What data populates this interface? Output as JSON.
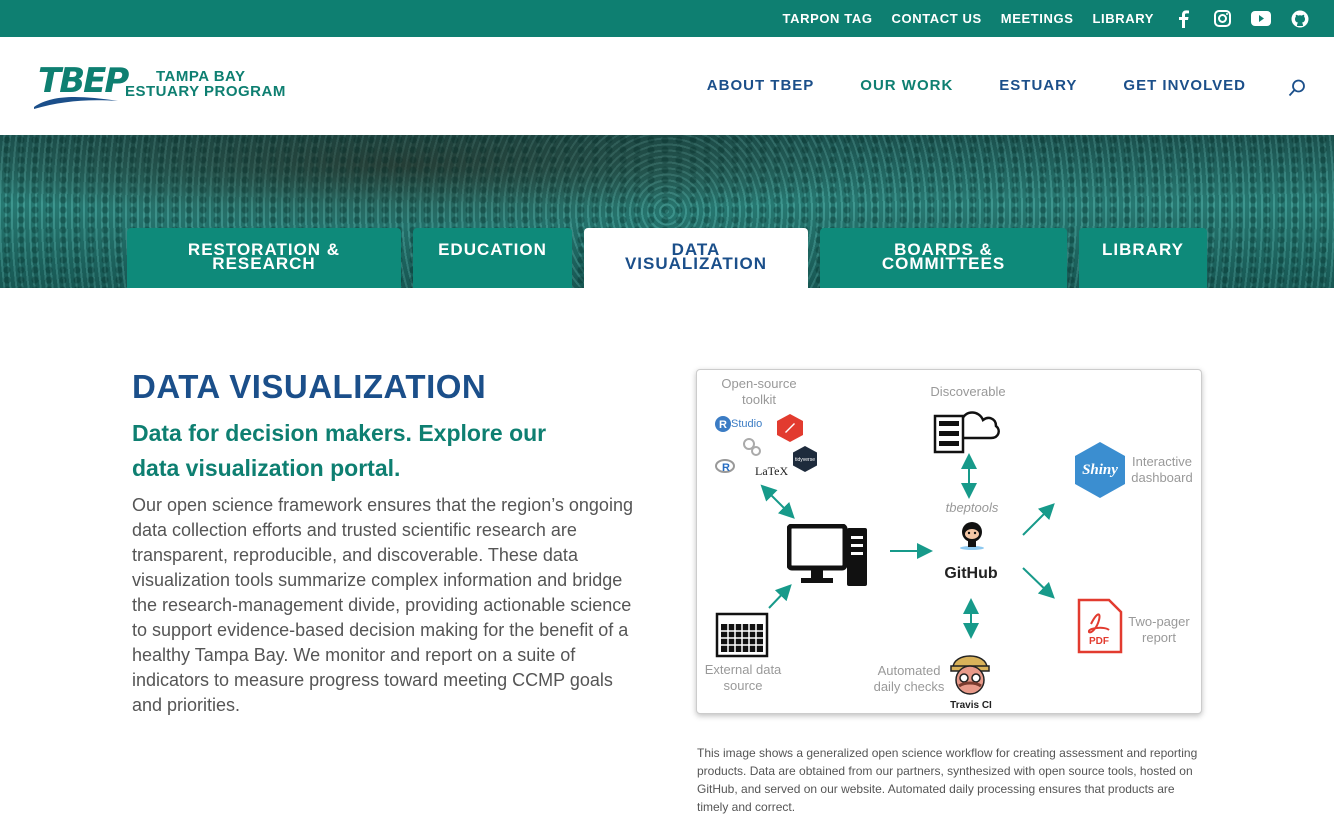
{
  "topbar": {
    "links": [
      "TARPON TAG",
      "CONTACT US",
      "MEETINGS",
      "LIBRARY"
    ],
    "social_icons": [
      "facebook-icon",
      "instagram-icon",
      "youtube-icon",
      "github-icon"
    ],
    "background": "#0e7f71"
  },
  "header": {
    "logo_mark": "TBEP",
    "logo_line1": "TAMPA BAY",
    "logo_line2": "ESTUARY PROGRAM",
    "nav": [
      "ABOUT TBEP",
      "OUR WORK",
      "ESTUARY",
      "GET INVOLVED"
    ],
    "active_nav": "OUR WORK"
  },
  "tabs": [
    {
      "line1": "RESTORATION &",
      "line2": "RESEARCH"
    },
    {
      "line1": "EDUCATION",
      "line2": ""
    },
    {
      "line1": "DATA",
      "line2": "VISUALIZATION"
    },
    {
      "line1": "BOARDS &",
      "line2": "COMMITTEES"
    },
    {
      "line1": "LIBRARY",
      "line2": ""
    }
  ],
  "active_tab": "DATA VISUALIZATION",
  "main": {
    "title": "DATA VISUALIZATION",
    "subtitle_line1": "Data for decision makers. Explore our",
    "subtitle_line2": "data visualization portal.",
    "body": "Our open science framework ensures that the region’s ongoing data collection efforts and trusted scientific research are transparent, reproducible, and discoverable. These data visualization tools summarize complex information and bridge the research-management divide, providing actionable science to support evidence-based decision making for the benefit of a healthy Tampa Bay.  We monitor and report on a suite of indicators to measure progress toward meeting CCMP goals and priorities."
  },
  "figure": {
    "open_source_line1": "Open-source",
    "open_source_line2": "toolkit",
    "rstudio": "Studio",
    "r_letter": "R",
    "latex": "LaTeX",
    "discoverable": "Discoverable",
    "tbeptools": "tbeptools",
    "github": "GitHub",
    "interactive_line1": "Interactive",
    "interactive_line2": "dashboard",
    "shiny": "Shiny",
    "twopager_line1": "Two-pager",
    "twopager_line2": "report",
    "pdf": "PDF",
    "external_line1": "External data",
    "external_line2": "source",
    "automated_line1": "Automated",
    "automated_line2": "daily checks",
    "travis": "Travis CI"
  },
  "caption": "This image shows a generalized open science workflow for creating assessment and reporting products. Data are obtained from our partners, synthesized with open source tools, hosted on GitHub, and served on our website. Automated daily processing ensures that products are timely and correct.",
  "colors": {
    "teal": "#0e7f71",
    "navy": "#1b4f8a",
    "arrow": "#179a8a"
  }
}
